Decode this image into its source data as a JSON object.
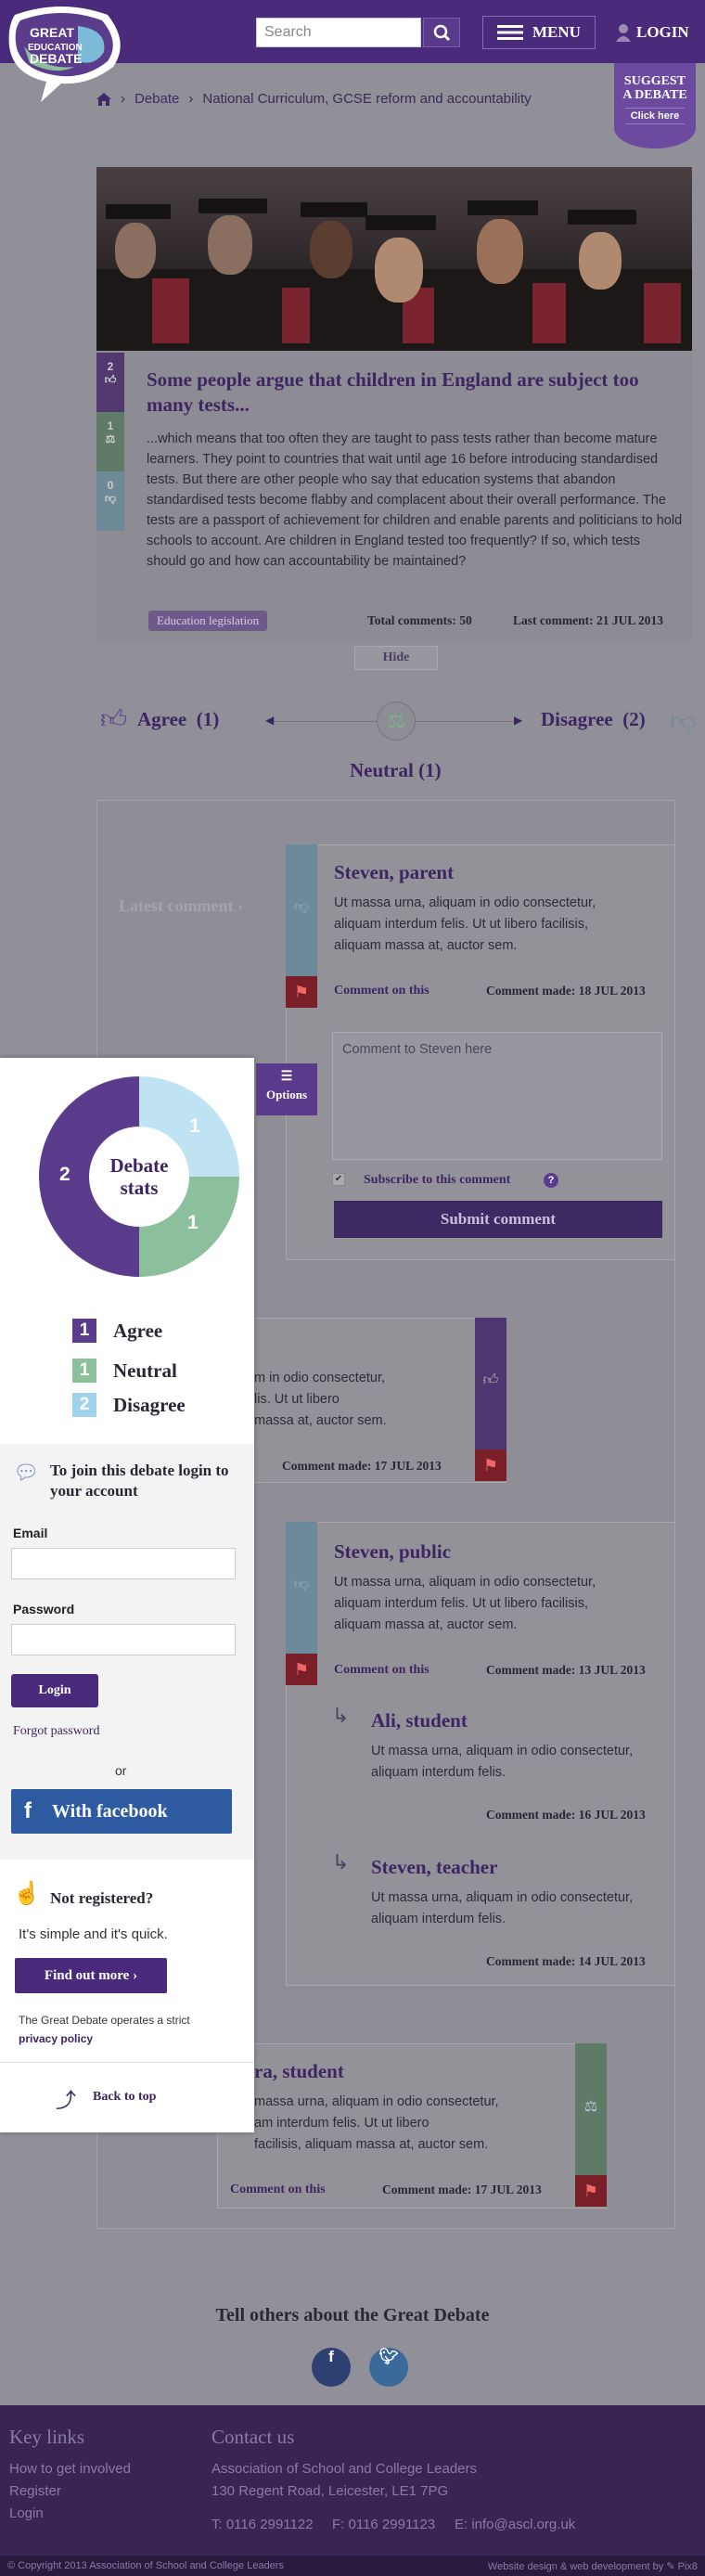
{
  "header": {
    "logo_lines": [
      "GREAT",
      "EDUCATION",
      "DEBATE"
    ],
    "search_placeholder": "Search",
    "menu_label": "MENU",
    "login_label": "LOGIN",
    "suggest_line1": "SUGGEST",
    "suggest_line2": "A DEBATE",
    "suggest_click": "Click here"
  },
  "breadcrumb": {
    "items": [
      "Debate",
      "National Curriculum, GCSE reform and accountability"
    ]
  },
  "article": {
    "title": "Some people argue that children in England are subject too many tests...",
    "body": "...which means that too often they are taught to pass tests rather than become mature learners. They point to countries that wait until age 16 before introducing standardised tests. But there are other people who say that education systems that abandon standardised tests become flabby and complacent about their overall performance. The tests are a passport of achievement for children and enable parents and politicians to hold schools to account. Are children in England tested too frequently? If so, which tests should go and how can accountability be maintained?",
    "tag": "Education legislation",
    "total_comments": "Total comments: 50",
    "last_comment": "Last comment: 21 JUL 2013",
    "hide_label": "Hide",
    "votes": {
      "agree": "2",
      "neutral": "1",
      "disagree": "0"
    }
  },
  "votes": {
    "agree": "Agree",
    "agree_count": "(1)",
    "disagree": "Disagree",
    "disagree_count": "(2)",
    "neutral": "Neutral",
    "neutral_count": "(1)"
  },
  "comments": {
    "latest_label": "Latest comment ›",
    "c1": {
      "author": "Steven, parent",
      "text": "Ut massa urna, aliquam in odio consectetur, aliquam interdum felis. Ut ut libero facilisis, aliquam massa at, auctor sem.",
      "link": "Comment on this",
      "date": "Comment made: 18 JUL 2013",
      "reply_placeholder": "Comment to Steven here",
      "subscribe": "Subscribe to this comment",
      "submit": "Submit comment"
    },
    "c2": {
      "text_lines": [
        "m in odio consectetur,",
        "lis. Ut ut libero",
        "massa at, auctor sem."
      ],
      "date": "Comment made: 17 JUL 2013"
    },
    "c3": {
      "author": "Steven, public",
      "text": "Ut massa urna, aliquam in odio consectetur, aliquam interdum felis. Ut ut libero facilisis, aliquam massa at, auctor sem.",
      "link": "Comment on this",
      "date": "Comment made: 13 JUL 2013"
    },
    "r1": {
      "author": "Ali, student",
      "text": "Ut massa urna, aliquam in odio consectetur, aliquam interdum felis.",
      "date": "Comment made: 16 JUL 2013"
    },
    "r2": {
      "author": "Steven, teacher",
      "text": "Ut massa urna, aliquam in odio consectetur, aliquam interdum felis.",
      "date": "Comment made: 14 JUL 2013"
    },
    "c4": {
      "author": "ra, student",
      "text_lines": [
        "massa urna, aliquam in odio consectetur,",
        "am interdum felis. Ut ut libero",
        "facilisis, aliquam massa at, auctor sem."
      ],
      "link": "Comment on this",
      "date": "Comment made: 17 JUL 2013"
    }
  },
  "sidebar": {
    "stats_title": "Debate stats",
    "donut": {
      "agree": "2",
      "neutral": "1",
      "disagree": "1"
    },
    "options_label": "Options",
    "legend": [
      {
        "num": "1",
        "label": "Agree",
        "color": "#5b3b8c"
      },
      {
        "num": "1",
        "label": "Neutral",
        "color": "#8cbf9c"
      },
      {
        "num": "2",
        "label": "Disagree",
        "color": "#9fd2ec"
      }
    ],
    "join_title": "To join this debate login to your account",
    "email_label": "Email",
    "password_label": "Password",
    "login_button": "Login",
    "forgot": "Forgot password",
    "or": "or",
    "facebook": "With facebook",
    "not_registered": "Not registered?",
    "simple": "It's simple and it's quick.",
    "find_out": "Find out more ›",
    "policy_text": "The Great Debate operates a strict",
    "policy_link": "privacy policy",
    "back_to_top": "Back to top"
  },
  "share": {
    "title": "Tell others about the Great Debate"
  },
  "footer": {
    "key_links_title": "Key links",
    "key_links": [
      "How to get involved",
      "Register",
      "Login"
    ],
    "contact_title": "Contact us",
    "org": "Association of School and College Leaders",
    "address": "130 Regent Road, Leicester, LE1 7PG",
    "tel": "T: 0116 2991122",
    "fax": "F: 0116 2991123",
    "email": "E: info@ascl.org.uk",
    "copyright": "© Copyright 2013 Association of School and College Leaders",
    "credit": "Website design & web development by ✎ Pix8"
  }
}
